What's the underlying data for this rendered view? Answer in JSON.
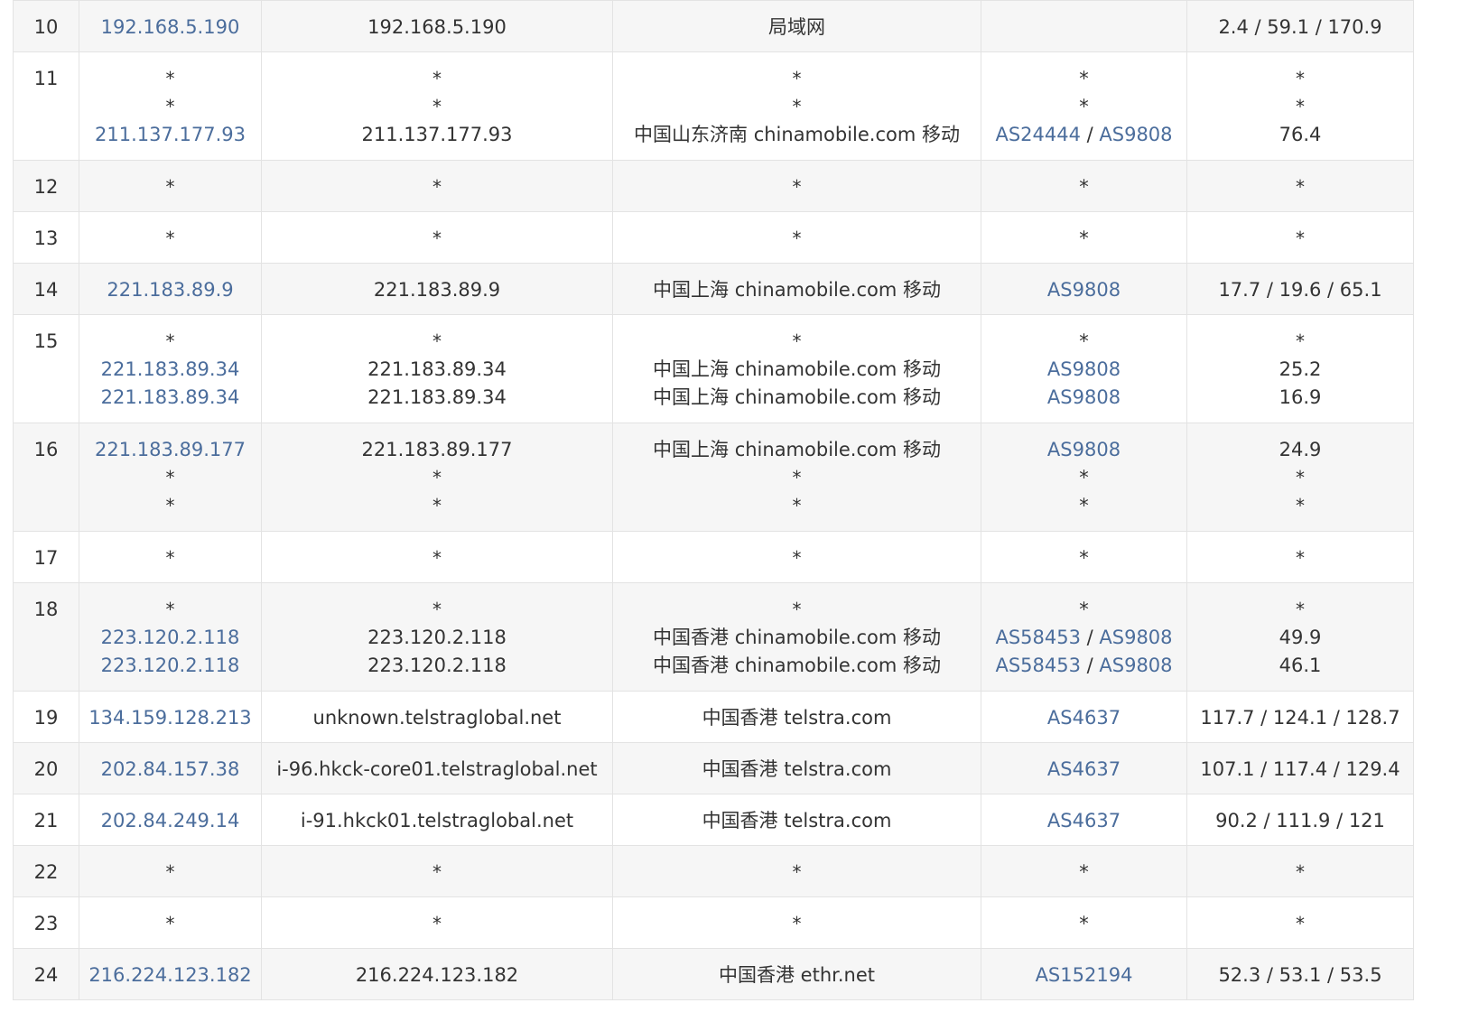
{
  "colors": {
    "link": "#4b6d9c",
    "text": "#333333",
    "stripe": "#f6f6f6",
    "border": "#e3e3e3"
  },
  "rows": [
    {
      "hop": "10",
      "ip": [
        "192.168.5.190"
      ],
      "host": [
        "192.168.5.190"
      ],
      "loc": [
        "局域网"
      ],
      "asn": [
        []
      ],
      "rtt": [
        "2.4 / 59.1 / 170.9"
      ]
    },
    {
      "hop": "11",
      "ip": [
        "*",
        "*",
        "211.137.177.93"
      ],
      "host": [
        "*",
        "*",
        "211.137.177.93"
      ],
      "loc": [
        "*",
        "*",
        "中国山东济南 chinamobile.com 移动"
      ],
      "asn": [
        [
          "*"
        ],
        [
          "*"
        ],
        [
          "AS24444",
          "AS9808"
        ]
      ],
      "rtt": [
        "*",
        "*",
        "76.4"
      ]
    },
    {
      "hop": "12",
      "ip": [
        "*"
      ],
      "host": [
        "*"
      ],
      "loc": [
        "*"
      ],
      "asn": [
        [
          "*"
        ]
      ],
      "rtt": [
        "*"
      ]
    },
    {
      "hop": "13",
      "ip": [
        "*"
      ],
      "host": [
        "*"
      ],
      "loc": [
        "*"
      ],
      "asn": [
        [
          "*"
        ]
      ],
      "rtt": [
        "*"
      ]
    },
    {
      "hop": "14",
      "ip": [
        "221.183.89.9"
      ],
      "host": [
        "221.183.89.9"
      ],
      "loc": [
        "中国上海 chinamobile.com 移动"
      ],
      "asn": [
        [
          "AS9808"
        ]
      ],
      "rtt": [
        "17.7 / 19.6 / 65.1"
      ]
    },
    {
      "hop": "15",
      "ip": [
        "*",
        "221.183.89.34",
        "221.183.89.34"
      ],
      "host": [
        "*",
        "221.183.89.34",
        "221.183.89.34"
      ],
      "loc": [
        "*",
        "中国上海 chinamobile.com 移动",
        "中国上海 chinamobile.com 移动"
      ],
      "asn": [
        [
          "*"
        ],
        [
          "AS9808"
        ],
        [
          "AS9808"
        ]
      ],
      "rtt": [
        "*",
        "25.2",
        "16.9"
      ]
    },
    {
      "hop": "16",
      "ip": [
        "221.183.89.177",
        "*",
        "*"
      ],
      "host": [
        "221.183.89.177",
        "*",
        "*"
      ],
      "loc": [
        "中国上海 chinamobile.com 移动",
        "*",
        "*"
      ],
      "asn": [
        [
          "AS9808"
        ],
        [
          "*"
        ],
        [
          "*"
        ]
      ],
      "rtt": [
        "24.9",
        "*",
        "*"
      ]
    },
    {
      "hop": "17",
      "ip": [
        "*"
      ],
      "host": [
        "*"
      ],
      "loc": [
        "*"
      ],
      "asn": [
        [
          "*"
        ]
      ],
      "rtt": [
        "*"
      ]
    },
    {
      "hop": "18",
      "ip": [
        "*",
        "223.120.2.118",
        "223.120.2.118"
      ],
      "host": [
        "*",
        "223.120.2.118",
        "223.120.2.118"
      ],
      "loc": [
        "*",
        "中国香港 chinamobile.com 移动",
        "中国香港 chinamobile.com 移动"
      ],
      "asn": [
        [
          "*"
        ],
        [
          "AS58453",
          "AS9808"
        ],
        [
          "AS58453",
          "AS9808"
        ]
      ],
      "rtt": [
        "*",
        "49.9",
        "46.1"
      ]
    },
    {
      "hop": "19",
      "ip": [
        "134.159.128.213"
      ],
      "host": [
        "unknown.telstraglobal.net"
      ],
      "loc": [
        "中国香港 telstra.com"
      ],
      "asn": [
        [
          "AS4637"
        ]
      ],
      "rtt": [
        "117.7 / 124.1 / 128.7"
      ]
    },
    {
      "hop": "20",
      "ip": [
        "202.84.157.38"
      ],
      "host": [
        "i-96.hkck-core01.telstraglobal.net"
      ],
      "loc": [
        "中国香港 telstra.com"
      ],
      "asn": [
        [
          "AS4637"
        ]
      ],
      "rtt": [
        "107.1 / 117.4 / 129.4"
      ]
    },
    {
      "hop": "21",
      "ip": [
        "202.84.249.14"
      ],
      "host": [
        "i-91.hkck01.telstraglobal.net"
      ],
      "loc": [
        "中国香港 telstra.com"
      ],
      "asn": [
        [
          "AS4637"
        ]
      ],
      "rtt": [
        "90.2 / 111.9 / 121"
      ]
    },
    {
      "hop": "22",
      "ip": [
        "*"
      ],
      "host": [
        "*"
      ],
      "loc": [
        "*"
      ],
      "asn": [
        [
          "*"
        ]
      ],
      "rtt": [
        "*"
      ]
    },
    {
      "hop": "23",
      "ip": [
        "*"
      ],
      "host": [
        "*"
      ],
      "loc": [
        "*"
      ],
      "asn": [
        [
          "*"
        ]
      ],
      "rtt": [
        "*"
      ]
    },
    {
      "hop": "24",
      "ip": [
        "216.224.123.182"
      ],
      "host": [
        "216.224.123.182"
      ],
      "loc": [
        "中国香港 ethr.net"
      ],
      "asn": [
        [
          "AS152194"
        ]
      ],
      "rtt": [
        "52.3 / 53.1 / 53.5"
      ]
    }
  ]
}
